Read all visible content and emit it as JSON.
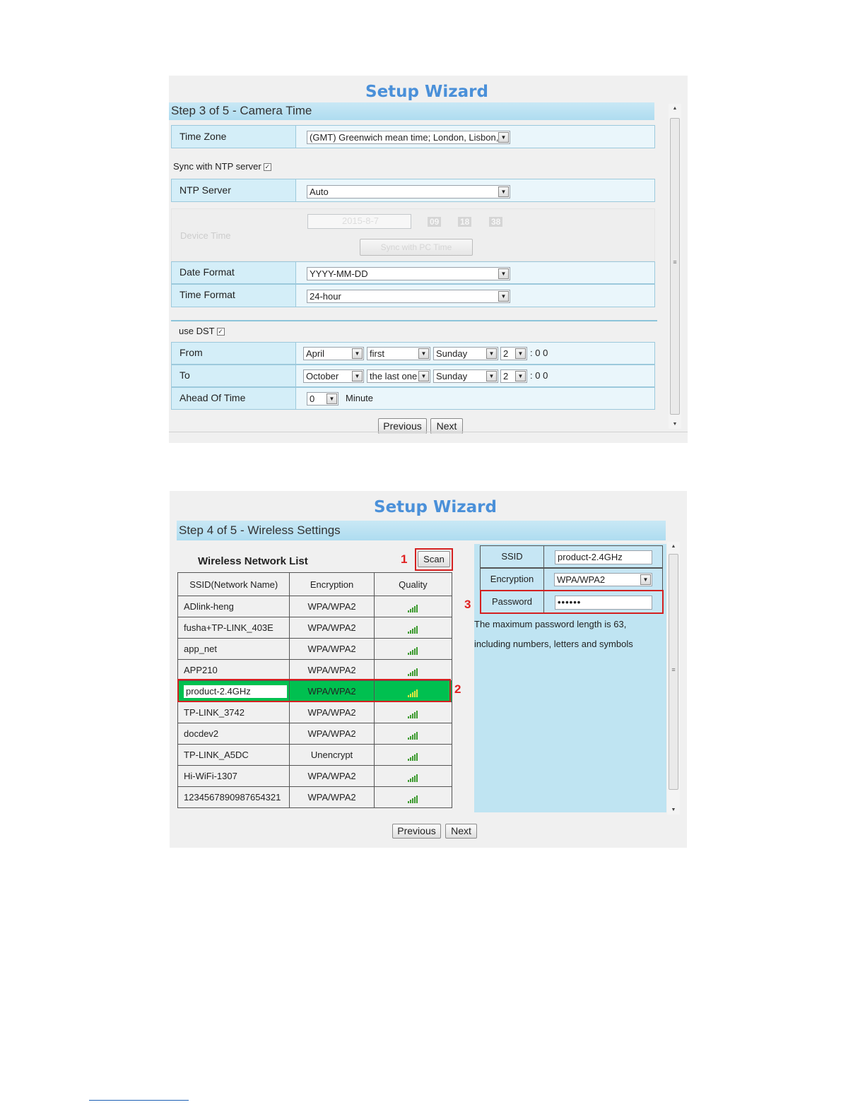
{
  "wizard1": {
    "title": "Setup Wizard",
    "step": "Step 3 of 5 - Camera Time",
    "time_zone_label": "Time Zone",
    "time_zone_value": "(GMT) Greenwich mean time; London, Lisbon,",
    "sync_ntp_label": "Sync with NTP server",
    "ntp_server_label": "NTP Server",
    "ntp_server_value": "Auto",
    "device_time_label": "Device Time",
    "device_date": "2015-8-7",
    "device_hour": "09",
    "device_min": "18",
    "device_sec": "38",
    "sync_pc_button": "Sync with PC Time",
    "date_format_label": "Date Format",
    "date_format_value": "YYYY-MM-DD",
    "time_format_label": "Time Format",
    "time_format_value": "24-hour",
    "use_dst_label": "use DST",
    "from_label": "From",
    "from_month": "April",
    "from_week": "first",
    "from_day": "Sunday",
    "from_hour": "2",
    "from_suffix": ": 0 0",
    "to_label": "To",
    "to_month": "October",
    "to_week": "the last one",
    "to_day": "Sunday",
    "to_hour": "2",
    "to_suffix": ": 0 0",
    "ahead_label": "Ahead Of Time",
    "ahead_value": "0",
    "minute_label": "Minute",
    "previous": "Previous",
    "next": "Next"
  },
  "wizard2": {
    "title": "Setup Wizard",
    "step": "Step 4 of 5 - Wireless Settings",
    "list_title": "Wireless Network List",
    "scan_button": "Scan",
    "marker1": "1",
    "marker2": "2",
    "marker3": "3",
    "columns": [
      "SSID(Network Name)",
      "Encryption",
      "Quality"
    ],
    "networks": [
      {
        "ssid": "ADlink-heng",
        "enc": "WPA/WPA2"
      },
      {
        "ssid": "fusha+TP-LINK_403E",
        "enc": "WPA/WPA2"
      },
      {
        "ssid": "app_net",
        "enc": "WPA/WPA2"
      },
      {
        "ssid": "APP210",
        "enc": "WPA/WPA2"
      },
      {
        "ssid": "product-2.4GHz",
        "enc": "WPA/WPA2"
      },
      {
        "ssid": "TP-LINK_3742",
        "enc": "WPA/WPA2"
      },
      {
        "ssid": "docdev2",
        "enc": "WPA/WPA2"
      },
      {
        "ssid": "TP-LINK_A5DC",
        "enc": "Unencrypt"
      },
      {
        "ssid": "Hi-WiFi-1307",
        "enc": "WPA/WPA2"
      },
      {
        "ssid": "1234567890987654321",
        "enc": "WPA/WPA2"
      }
    ],
    "selected_index": 4,
    "ssid_label": "SSID",
    "ssid_value": "product-2.4GHz",
    "encryption_label": "Encryption",
    "encryption_value": "WPA/WPA2",
    "password_label": "Password",
    "password_value": "••••••",
    "hint_line1": "The maximum password length is 63,",
    "hint_line2": "including numbers, letters and symbols",
    "previous": "Previous",
    "next": "Next"
  },
  "colors": {
    "title_blue": "#4a90d9",
    "selected_row": "#00c050",
    "highlight_red": "#d42020",
    "signal_green": "#3c9a2e"
  }
}
